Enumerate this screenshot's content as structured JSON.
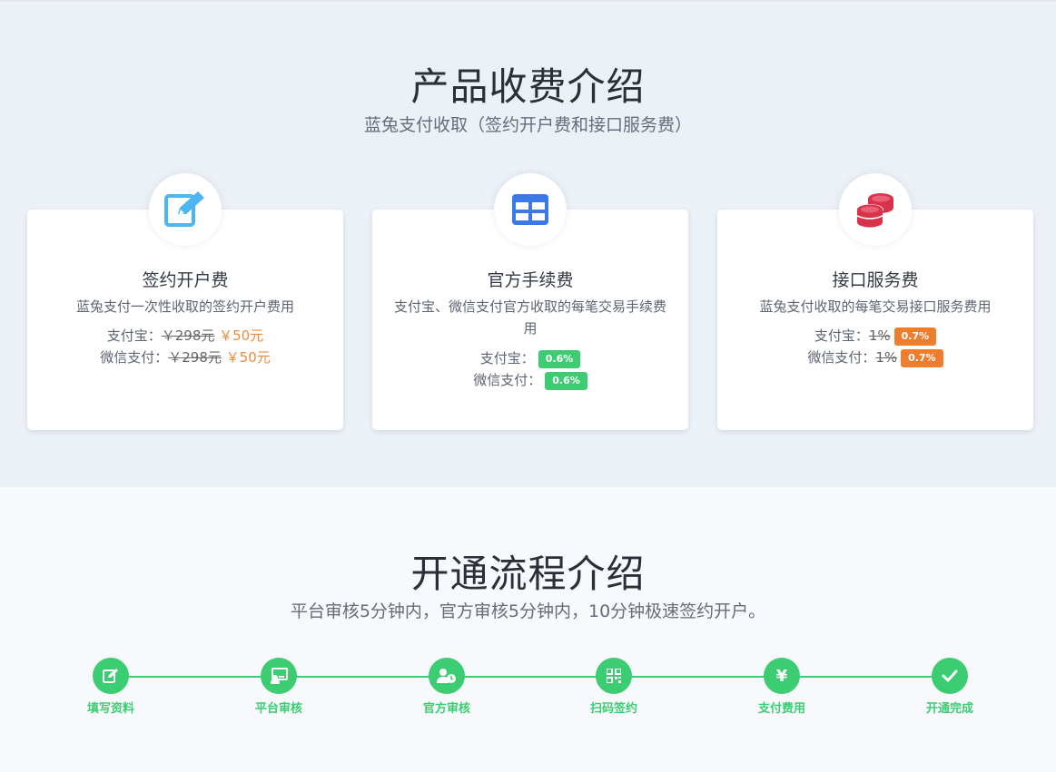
{
  "fees": {
    "title": "产品收费介绍",
    "subtitle": "蓝兔支付收取（签约开户费和接口服务费）",
    "cards": [
      {
        "icon": "edit-icon",
        "title": "签约开户费",
        "desc": "蓝兔支付一次性收取的签约开户费用",
        "rows": [
          {
            "label": "支付宝：",
            "old": "￥298元",
            "new": "￥50元"
          },
          {
            "label": "微信支付：",
            "old": "￥298元",
            "new": "￥50元"
          }
        ]
      },
      {
        "icon": "table-icon",
        "title": "官方手续费",
        "desc": "支付宝、微信支付官方收取的每笔交易手续费用",
        "rows": [
          {
            "label": "支付宝：",
            "badge": "0.6%"
          },
          {
            "label": "微信支付：",
            "badge": "0.6%"
          }
        ]
      },
      {
        "icon": "coins-icon",
        "title": "接口服务费",
        "desc": "蓝兔支付收取的每笔交易接口服务费用",
        "rows": [
          {
            "label": "支付宝：",
            "old": "1%",
            "badge": "0.7%"
          },
          {
            "label": "微信支付：",
            "old": "1%",
            "badge": "0.7%"
          }
        ]
      }
    ]
  },
  "process": {
    "title": "开通流程介绍",
    "subtitle": "平台审核5分钟内，官方审核5分钟内，10分钟极速签约开户。",
    "steps": [
      {
        "icon": "edit-icon",
        "label": "填写资料"
      },
      {
        "icon": "review-icon",
        "label": "平台审核"
      },
      {
        "icon": "user-clock-icon",
        "label": "官方审核"
      },
      {
        "icon": "qrcode-icon",
        "label": "扫码签约"
      },
      {
        "icon": "yen-icon",
        "label": "支付费用"
      },
      {
        "icon": "check-icon",
        "label": "开通完成"
      }
    ]
  },
  "colors": {
    "accent_green": "#3ccd72",
    "accent_orange": "#ee7e2e",
    "edit_icon_blue": "#4db5f0",
    "table_icon_blue": "#3b7ae6",
    "coins_icon_red": "#d8334a"
  }
}
